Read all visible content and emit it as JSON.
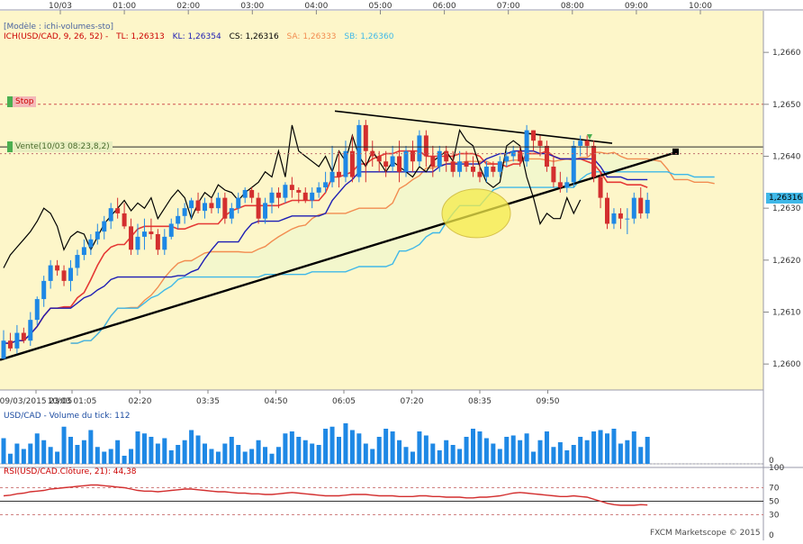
{
  "top_axis": {
    "labels": [
      "10/03",
      "01:00",
      "02:00",
      "03:00",
      "04:00",
      "05:00",
      "06:00",
      "07:00",
      "08:00",
      "09:00",
      "10:00"
    ]
  },
  "main_panel": {
    "template": "[Modèle : ichi-volumes-sto]",
    "indicator": "ICH(USD/CAD, 9, 26, 52) -",
    "tl": "TL: 1,26313",
    "kl": "KL: 1,26354",
    "cs": "CS: 1,26316",
    "sa": "SA: 1,26333",
    "sb": "SB: 1,26360",
    "stop_label": "Stop",
    "sell_label": "Vente(10/03 08:23,8,2)",
    "last_price": "1,26316",
    "y_ticks": [
      "1,2660",
      "1,2650",
      "1,2640",
      "1,2630",
      "1,2620",
      "1,2610",
      "1,2600"
    ]
  },
  "bottom_axis": {
    "labels": [
      "09/03/2015 23:05",
      "10/03 01:05",
      "02:20",
      "03:35",
      "04:50",
      "06:05",
      "07:20",
      "08:35",
      "09:50"
    ]
  },
  "volume_panel": {
    "title": "USD/CAD - Volume du tick: 112",
    "y_ticks": [
      "0"
    ]
  },
  "rsi_panel": {
    "title": "RSI(USD/CAD.Clôture, 21): 44,38",
    "y_ticks": [
      "100",
      "70",
      "50",
      "30",
      "0"
    ]
  },
  "footer": "FXCM Marketscope © 2015",
  "colors": {
    "bull": "#1e88e5",
    "bear": "#d32f2f",
    "tenkan": "#e53935",
    "kijun": "#1e1eb4",
    "chikou": "#000000",
    "senkou_a": "#f28c50",
    "senkou_b": "#3fb8e8",
    "cloud": "#f2f7cc",
    "background": "#fdf6c9",
    "volume": "#1e88e5",
    "rsi": "#d32f2f"
  },
  "chart_data": {
    "type": "candlestick",
    "x_labels": [
      "09/03/2015 23:05",
      "10/03 01:05",
      "02:20",
      "03:35",
      "04:50",
      "06:05",
      "07:20",
      "08:35",
      "09:50"
    ],
    "ylim": [
      1.2595,
      1.2668
    ],
    "candles": [
      [
        1.2601,
        1.26045,
        1.26015,
        1.26065
      ],
      [
        1.26045,
        1.2603,
        1.26025,
        1.2606
      ],
      [
        1.2603,
        1.2606,
        1.2602,
        1.26075
      ],
      [
        1.2606,
        1.26045,
        1.2604,
        1.2607
      ],
      [
        1.26045,
        1.26085,
        1.26035,
        1.261
      ],
      [
        1.26085,
        1.26125,
        1.26075,
        1.2613
      ],
      [
        1.26125,
        1.2616,
        1.2611,
        1.2617
      ],
      [
        1.2616,
        1.2619,
        1.26145,
        1.262
      ],
      [
        1.2619,
        1.2618,
        1.2617,
        1.262
      ],
      [
        1.2618,
        1.2616,
        1.2615,
        1.2619
      ],
      [
        1.2616,
        1.26185,
        1.2614,
        1.262
      ],
      [
        1.26185,
        1.2621,
        1.2617,
        1.2622
      ],
      [
        1.2621,
        1.26225,
        1.262,
        1.2624
      ],
      [
        1.26225,
        1.2624,
        1.2621,
        1.2625
      ],
      [
        1.2624,
        1.26255,
        1.2623,
        1.2627
      ],
      [
        1.26255,
        1.26275,
        1.2624,
        1.26285
      ],
      [
        1.26275,
        1.263,
        1.2626,
        1.2631
      ],
      [
        1.263,
        1.2629,
        1.2628,
        1.2632
      ],
      [
        1.2629,
        1.26265,
        1.2626,
        1.2631
      ],
      [
        1.26265,
        1.2622,
        1.2621,
        1.2628
      ],
      [
        1.2622,
        1.26245,
        1.2621,
        1.2627
      ],
      [
        1.26245,
        1.26255,
        1.2622,
        1.2628
      ],
      [
        1.26255,
        1.2625,
        1.2624,
        1.2628
      ],
      [
        1.2625,
        1.2622,
        1.2621,
        1.2626
      ],
      [
        1.2622,
        1.26245,
        1.2621,
        1.2626
      ],
      [
        1.26245,
        1.2627,
        1.2624,
        1.2628
      ],
      [
        1.2627,
        1.26285,
        1.2626,
        1.263
      ],
      [
        1.26285,
        1.263,
        1.2627,
        1.2631
      ],
      [
        1.263,
        1.26315,
        1.2628,
        1.2632
      ],
      [
        1.26315,
        1.26295,
        1.2629,
        1.2633
      ],
      [
        1.26295,
        1.2631,
        1.2628,
        1.2632
      ],
      [
        1.2631,
        1.263,
        1.2629,
        1.2632
      ],
      [
        1.263,
        1.2632,
        1.2629,
        1.2633
      ],
      [
        1.2632,
        1.2628,
        1.2627,
        1.2633
      ],
      [
        1.2628,
        1.263,
        1.2627,
        1.2631
      ],
      [
        1.263,
        1.2632,
        1.2629,
        1.2633
      ],
      [
        1.2632,
        1.26335,
        1.2631,
        1.2634
      ],
      [
        1.26335,
        1.2632,
        1.2631,
        1.2634
      ],
      [
        1.2632,
        1.2628,
        1.2627,
        1.2633
      ],
      [
        1.2628,
        1.2631,
        1.2627,
        1.2632
      ],
      [
        1.2631,
        1.2633,
        1.2629,
        1.2634
      ],
      [
        1.2633,
        1.2632,
        1.263,
        1.2634
      ],
      [
        1.2632,
        1.26345,
        1.2631,
        1.2635
      ],
      [
        1.26345,
        1.26335,
        1.2632,
        1.2636
      ],
      [
        1.26335,
        1.2633,
        1.2631,
        1.2634
      ],
      [
        1.2633,
        1.26315,
        1.2631,
        1.2634
      ],
      [
        1.26315,
        1.2633,
        1.263,
        1.2634
      ],
      [
        1.2633,
        1.2634,
        1.2632,
        1.2635
      ],
      [
        1.2634,
        1.2635,
        1.2633,
        1.2637
      ],
      [
        1.2635,
        1.2637,
        1.2634,
        1.2642
      ],
      [
        1.2637,
        1.2636,
        1.2634,
        1.2641
      ],
      [
        1.2636,
        1.2641,
        1.2635,
        1.2643
      ],
      [
        1.2641,
        1.2636,
        1.2635,
        1.2644
      ],
      [
        1.2636,
        1.2646,
        1.2635,
        1.2647
      ],
      [
        1.2646,
        1.2641,
        1.2635,
        1.2647
      ],
      [
        1.2641,
        1.264,
        1.2638,
        1.2643
      ],
      [
        1.264,
        1.2639,
        1.2637,
        1.2641
      ],
      [
        1.2639,
        1.2638,
        1.2636,
        1.2641
      ],
      [
        1.2638,
        1.264,
        1.2637,
        1.2642
      ],
      [
        1.264,
        1.2637,
        1.2635,
        1.2643
      ],
      [
        1.2637,
        1.2641,
        1.2636,
        1.2642
      ],
      [
        1.2641,
        1.2639,
        1.2637,
        1.2643
      ],
      [
        1.2639,
        1.2644,
        1.2638,
        1.2645
      ],
      [
        1.2644,
        1.264,
        1.2638,
        1.2645
      ],
      [
        1.264,
        1.2638,
        1.2636,
        1.2642
      ],
      [
        1.2638,
        1.2641,
        1.2637,
        1.2642
      ],
      [
        1.2641,
        1.2639,
        1.2637,
        1.2642
      ],
      [
        1.2639,
        1.2637,
        1.2636,
        1.2641
      ],
      [
        1.2637,
        1.2639,
        1.2636,
        1.2641
      ],
      [
        1.2639,
        1.2638,
        1.2637,
        1.2641
      ],
      [
        1.2638,
        1.2637,
        1.2636,
        1.264
      ],
      [
        1.2637,
        1.2636,
        1.2635,
        1.2639
      ],
      [
        1.2636,
        1.2638,
        1.2635,
        1.2639
      ],
      [
        1.2638,
        1.2637,
        1.2636,
        1.2639
      ],
      [
        1.2637,
        1.2639,
        1.2636,
        1.264
      ],
      [
        1.2639,
        1.264,
        1.2638,
        1.2641
      ],
      [
        1.264,
        1.2641,
        1.2639,
        1.2642
      ],
      [
        1.2641,
        1.2639,
        1.2638,
        1.2642
      ],
      [
        1.2639,
        1.2645,
        1.2638,
        1.2646
      ],
      [
        1.2645,
        1.2643,
        1.2641,
        1.2645
      ],
      [
        1.2643,
        1.2642,
        1.264,
        1.2644
      ],
      [
        1.2642,
        1.2638,
        1.2637,
        1.2643
      ],
      [
        1.2638,
        1.2635,
        1.2634,
        1.264
      ],
      [
        1.2635,
        1.2634,
        1.2633,
        1.2637
      ],
      [
        1.2634,
        1.2635,
        1.2633,
        1.2636
      ],
      [
        1.2635,
        1.2642,
        1.2634,
        1.2643
      ],
      [
        1.2642,
        1.2643,
        1.264,
        1.2644
      ],
      [
        1.2643,
        1.2642,
        1.264,
        1.2644
      ],
      [
        1.2642,
        1.2636,
        1.2635,
        1.2643
      ],
      [
        1.2636,
        1.2632,
        1.263,
        1.2637
      ],
      [
        1.2632,
        1.2627,
        1.2626,
        1.2633
      ],
      [
        1.2627,
        1.2629,
        1.2626,
        1.263
      ],
      [
        1.2629,
        1.2628,
        1.2626,
        1.263
      ],
      [
        1.2628,
        1.2628,
        1.2625,
        1.263
      ],
      [
        1.2628,
        1.2632,
        1.2627,
        1.2633
      ],
      [
        1.2632,
        1.2629,
        1.2628,
        1.2634
      ],
      [
        1.2629,
        1.26316,
        1.2628,
        1.2633
      ]
    ],
    "volume": [
      38,
      15,
      30,
      22,
      30,
      45,
      35,
      25,
      18,
      55,
      40,
      28,
      35,
      50,
      25,
      18,
      22,
      35,
      12,
      22,
      48,
      45,
      40,
      30,
      38,
      20,
      28,
      35,
      50,
      42,
      30,
      22,
      18,
      30,
      40,
      28,
      18,
      22,
      35,
      25,
      15,
      25,
      45,
      48,
      40,
      35,
      30,
      28,
      52,
      55,
      40,
      60,
      50,
      45,
      30,
      22,
      40,
      52,
      48,
      35,
      25,
      18,
      48,
      42,
      30,
      20,
      35,
      28,
      22,
      40,
      52,
      48,
      38,
      30,
      22,
      40,
      42,
      35,
      45,
      18,
      35,
      48,
      25,
      32,
      20,
      28,
      40,
      35,
      48,
      50,
      45,
      52,
      30,
      35,
      48,
      25,
      40
    ],
    "rsi": [
      58,
      59,
      61,
      62,
      64,
      65,
      66,
      68,
      69,
      70,
      71,
      72,
      73,
      74,
      74,
      73,
      72,
      71,
      70,
      68,
      66,
      65,
      65,
      64,
      65,
      66,
      67,
      68,
      68,
      67,
      66,
      65,
      64,
      64,
      63,
      62,
      62,
      61,
      61,
      60,
      60,
      61,
      62,
      63,
      62,
      61,
      60,
      59,
      58,
      58,
      58,
      59,
      60,
      60,
      60,
      59,
      58,
      58,
      58,
      57,
      57,
      57,
      58,
      58,
      57,
      57,
      56,
      56,
      56,
      55,
      55,
      56,
      56,
      57,
      58,
      60,
      62,
      63,
      62,
      61,
      60,
      59,
      58,
      57,
      57,
      58,
      57,
      56,
      53,
      50,
      47,
      45,
      44,
      44,
      44,
      45,
      44.38
    ],
    "rsi_levels": [
      70,
      50,
      30
    ],
    "ylim_volume": [
      0,
      80
    ],
    "ylim_rsi": [
      0,
      100
    ]
  }
}
